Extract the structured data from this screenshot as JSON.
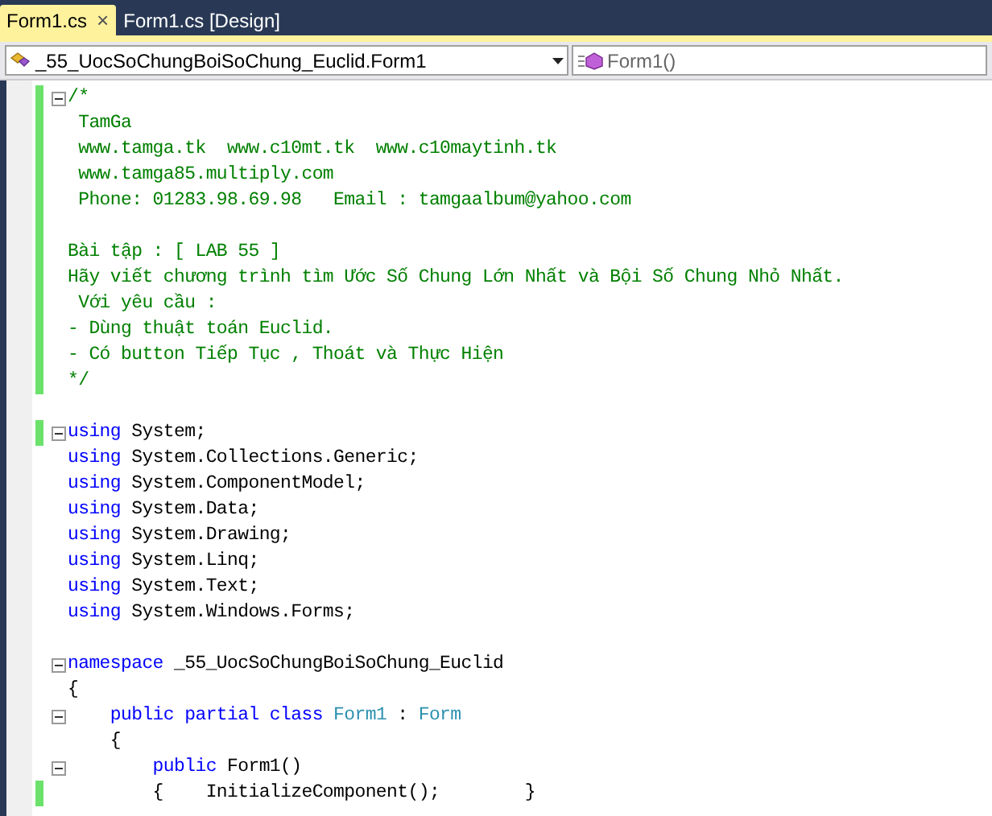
{
  "tabs": [
    {
      "label": "Form1.cs",
      "selected": true,
      "close": "×"
    },
    {
      "label": "Form1.cs [Design]",
      "selected": false
    }
  ],
  "navigation": {
    "type_dropdown": "_55_UocSoChungBoiSoChung_Euclid.Form1",
    "member_dropdown": "Form1()"
  },
  "code_lines": [
    {
      "changed": true,
      "fold": true,
      "segments": [
        {
          "kind": "comment",
          "text": "/*"
        }
      ]
    },
    {
      "changed": true,
      "fold": false,
      "segments": [
        {
          "kind": "comment",
          "text": " TamGa"
        }
      ]
    },
    {
      "changed": true,
      "fold": false,
      "segments": [
        {
          "kind": "comment",
          "text": " www.tamga.tk  www.c10mt.tk  www.c10maytinh.tk"
        }
      ]
    },
    {
      "changed": true,
      "fold": false,
      "segments": [
        {
          "kind": "comment",
          "text": " www.tamga85.multiply.com"
        }
      ]
    },
    {
      "changed": true,
      "fold": false,
      "segments": [
        {
          "kind": "comment",
          "text": " Phone: 01283.98.69.98   Email : tamgaalbum@yahoo.com"
        }
      ]
    },
    {
      "changed": true,
      "fold": false
    },
    {
      "changed": true,
      "fold": false,
      "segments": [
        {
          "kind": "comment",
          "text": "Bài tập : [ LAB 55 ]"
        }
      ]
    },
    {
      "changed": true,
      "fold": false,
      "segments": [
        {
          "kind": "comment",
          "text": "Hãy viết chương trình tìm Ước Số Chung Lớn Nhất và Bội Số Chung Nhỏ Nhất."
        }
      ]
    },
    {
      "changed": true,
      "fold": false,
      "segments": [
        {
          "kind": "comment",
          "text": " Với yêu cầu :"
        }
      ]
    },
    {
      "changed": true,
      "fold": false,
      "segments": [
        {
          "kind": "comment",
          "text": "- Dùng thuật toán Euclid."
        }
      ]
    },
    {
      "changed": true,
      "fold": false,
      "segments": [
        {
          "kind": "comment",
          "text": "- Có button Tiếp Tục , Thoát và Thực Hiện"
        }
      ]
    },
    {
      "changed": true,
      "fold": false,
      "segments": [
        {
          "kind": "comment",
          "text": "*/"
        }
      ]
    },
    {
      "changed": false,
      "fold": false
    },
    {
      "changed": true,
      "fold": true,
      "segments": [
        {
          "kind": "keyword",
          "text": "using"
        },
        {
          "kind": "plain",
          "text": " System;"
        }
      ]
    },
    {
      "changed": false,
      "fold": false,
      "segments": [
        {
          "kind": "keyword",
          "text": "using"
        },
        {
          "kind": "plain",
          "text": " System.Collections.Generic;"
        }
      ]
    },
    {
      "changed": false,
      "fold": false,
      "segments": [
        {
          "kind": "keyword",
          "text": "using"
        },
        {
          "kind": "plain",
          "text": " System.ComponentModel;"
        }
      ]
    },
    {
      "changed": false,
      "fold": false,
      "segments": [
        {
          "kind": "keyword",
          "text": "using"
        },
        {
          "kind": "plain",
          "text": " System.Data;"
        }
      ]
    },
    {
      "changed": false,
      "fold": false,
      "segments": [
        {
          "kind": "keyword",
          "text": "using"
        },
        {
          "kind": "plain",
          "text": " System.Drawing;"
        }
      ]
    },
    {
      "changed": false,
      "fold": false,
      "segments": [
        {
          "kind": "keyword",
          "text": "using"
        },
        {
          "kind": "plain",
          "text": " System.Linq;"
        }
      ]
    },
    {
      "changed": false,
      "fold": false,
      "segments": [
        {
          "kind": "keyword",
          "text": "using"
        },
        {
          "kind": "plain",
          "text": " System.Text;"
        }
      ]
    },
    {
      "changed": false,
      "fold": false,
      "segments": [
        {
          "kind": "keyword",
          "text": "using"
        },
        {
          "kind": "plain",
          "text": " System.Windows.Forms;"
        }
      ]
    },
    {
      "changed": false,
      "fold": false
    },
    {
      "changed": false,
      "fold": true,
      "segments": [
        {
          "kind": "keyword",
          "text": "namespace"
        },
        {
          "kind": "plain",
          "text": " _55_UocSoChungBoiSoChung_Euclid"
        }
      ]
    },
    {
      "changed": false,
      "fold": false,
      "segments": [
        {
          "kind": "plain",
          "text": "{"
        }
      ]
    },
    {
      "changed": false,
      "fold": true,
      "segments": [
        {
          "kind": "keyword",
          "text": "    public partial class"
        },
        {
          "kind": "type",
          "text": " Form1"
        },
        {
          "kind": "plain",
          "text": " : "
        },
        {
          "kind": "type",
          "text": "Form"
        }
      ]
    },
    {
      "changed": false,
      "fold": false,
      "segments": [
        {
          "kind": "plain",
          "text": "    {"
        }
      ]
    },
    {
      "changed": false,
      "fold": true,
      "segments": [
        {
          "kind": "keyword",
          "text": "        public"
        },
        {
          "kind": "plain",
          "text": " Form1()"
        }
      ]
    },
    {
      "changed": true,
      "fold": false,
      "segments": [
        {
          "kind": "plain",
          "text": "        {    InitializeComponent();        }"
        }
      ]
    }
  ]
}
